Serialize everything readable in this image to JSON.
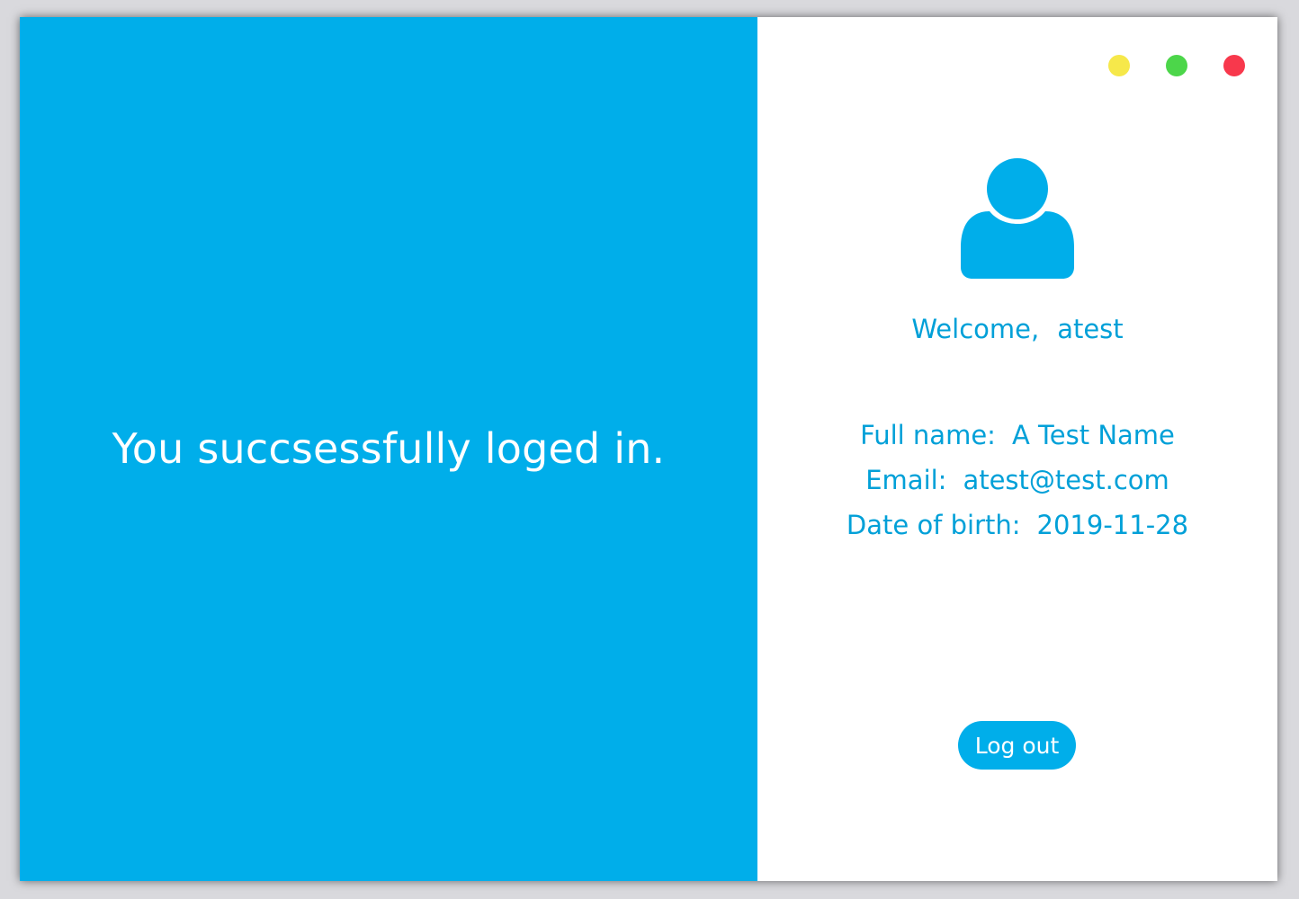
{
  "colors": {
    "accent": "#00aeea",
    "text_accent": "#00a0d8",
    "minimize": "#f6e84a",
    "maximize": "#4cd64a",
    "close": "#f8384c"
  },
  "window_controls": {
    "minimize_icon": "yellow-dot",
    "maximize_icon": "green-dot",
    "close_icon": "red-dot"
  },
  "left_panel": {
    "message": "You succsessfully loged in."
  },
  "profile": {
    "avatar_icon": "user-icon",
    "welcome_label": "Welcome,",
    "username": "atest",
    "fields": [
      {
        "label": "Full name:",
        "value": "A Test Name"
      },
      {
        "label": "Email:",
        "value": "atest@test.com"
      },
      {
        "label": "Date of birth:",
        "value": "2019-11-28"
      }
    ],
    "logout_label": "Log out"
  }
}
